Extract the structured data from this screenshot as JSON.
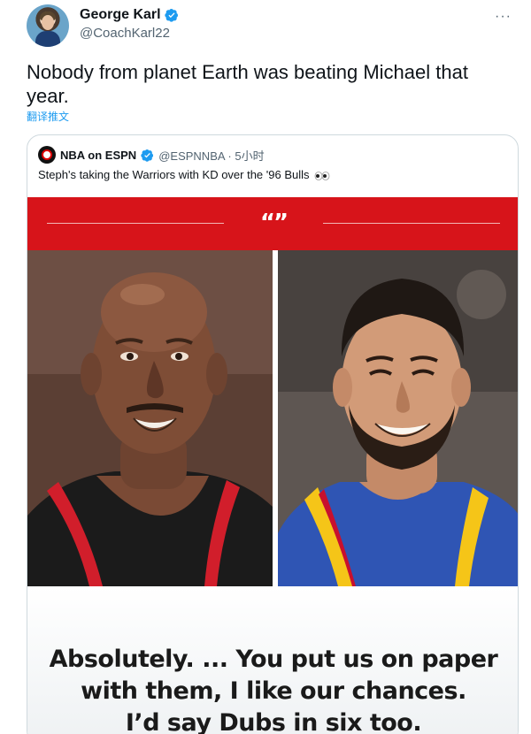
{
  "author": {
    "display_name": "George Karl",
    "handle": "@CoachKarl22",
    "verified": true,
    "avatar": "avatar-coach"
  },
  "menu_icon": "more-icon",
  "tweet_text": "Nobody from planet Earth was beating Michael that year.",
  "translate_label": "翻译推文",
  "quoted_tweet": {
    "author_name": "NBA on ESPN",
    "verified": true,
    "handle_time": "@ESPNNBA · 5小时",
    "text": "Steph's taking the Warriors with KD over the '96 Bulls",
    "emoji": "eyes-emoji",
    "media": {
      "banner_color": "#d7141a",
      "quote_mark": "“”",
      "photo_left": "michael-jordan-portrait",
      "photo_right": "stephen-curry-portrait",
      "caption_lines": [
        "Absolutely. ... You put us on paper",
        "with them, I like our chances.",
        "I’d say Dubs in six too."
      ]
    }
  },
  "colors": {
    "link": "#1d9bf0",
    "verified": "#1d9bf0",
    "secondary_text": "#536471",
    "border": "#cfd9de"
  }
}
